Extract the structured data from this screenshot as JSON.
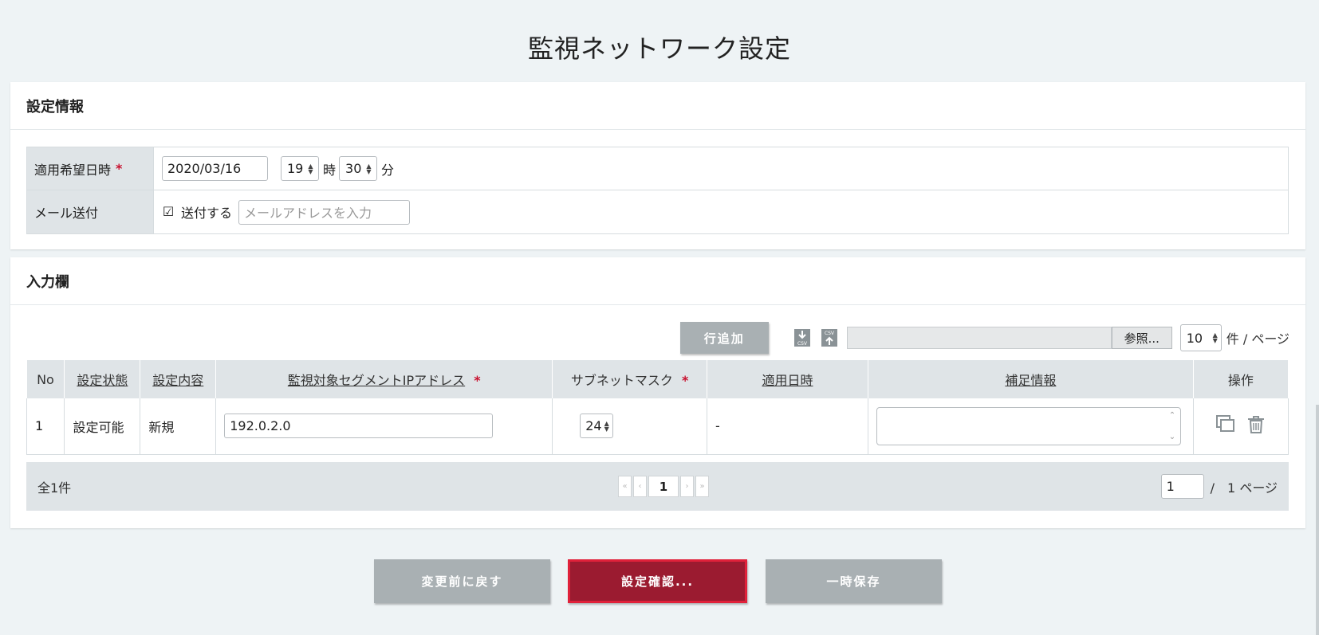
{
  "page": {
    "title": "監視ネットワーク設定"
  },
  "settings": {
    "header": "設定情報",
    "apply_date": {
      "label": "適用希望日時",
      "required_mark": "*",
      "date": "2020/03/16",
      "hour": "19",
      "hour_unit": "時",
      "minute": "30",
      "minute_unit": "分"
    },
    "mail": {
      "label": "メール送付",
      "checkbox_mark": "☑",
      "checkbox_label": "送付する",
      "placeholder": "メールアドレスを入力"
    }
  },
  "input_section": {
    "header": "入力欄",
    "toolbar": {
      "add_row": "行追加",
      "browse": "参照...",
      "per_page": "10",
      "per_page_label": "件 / ページ",
      "csv_label": "CSV"
    },
    "table": {
      "headers": [
        "No",
        "設定状態",
        "設定内容",
        "監視対象セグメントIPアドレス",
        "サブネットマスク",
        "適用日時",
        "補足情報",
        "操作"
      ],
      "required_mark": "*",
      "rows": [
        {
          "no": "1",
          "status": "設定可能",
          "content": "新規",
          "ip": "192.0.2.0",
          "mask": "24",
          "apply_date": "-",
          "note": ""
        }
      ]
    },
    "pager": {
      "total": "全1件",
      "current": "1",
      "page_input": "1",
      "page_total": "/　1 ページ"
    }
  },
  "buttons": {
    "revert": "変更前に戻す",
    "confirm": "設定確認...",
    "save": "一時保存"
  },
  "colors": {
    "accent": "#9b1b30",
    "required": "#c8102e",
    "button_gray": "#a9b0b3"
  }
}
